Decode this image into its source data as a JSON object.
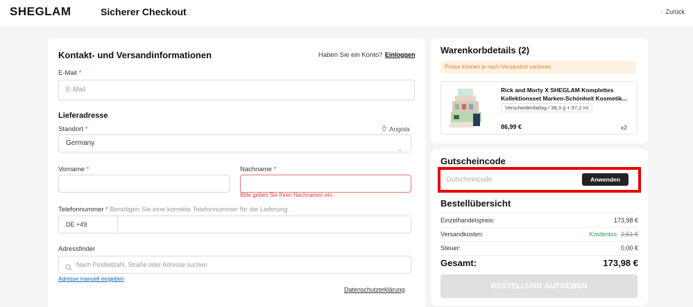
{
  "header": {
    "logo": "SHEGLAM",
    "title": "Sicherer Checkout",
    "back_label": "Zurück"
  },
  "contact": {
    "title": "Kontakt- und Versandinformationen",
    "account_prompt": "Haben Sie ein Konto?",
    "login_link": "Einloggen",
    "email_label": "E-Mail",
    "email_placeholder": "E-Mail",
    "address_title": "Lieferadresse",
    "location_label": "Standort",
    "location_hint": "Angola",
    "location_value": "Germany",
    "firstname_label": "Vorname",
    "lastname_label": "Nachname",
    "lastname_error": "Bitte geben Sie Ihren Nachnamen ein.",
    "phone_label": "Telefonnummer",
    "phone_hint": "Benötigen Sie eine korrekte Telefonnummer für die Lieferung.",
    "phone_prefix": "DE +49",
    "finder_label": "Adressfinder",
    "finder_placeholder": "Nach Postleitzahl, Straße oder Adresse suchen",
    "manual_link": "Adresse manuell eingeben",
    "privacy_link": "Datenschutzerklärung",
    "required_mark": "*"
  },
  "cart": {
    "title": "Warenkorbdetails (2)",
    "notice": "Preise können je nach Versandort variieren.",
    "product_name": "Rick and Morty X SHEGLAM Komplettes Kollektionsset Marken-Schönheit Kosmetik...",
    "variant": "Verschiedenfarbig / 38,3 g + 97,2 ml",
    "price": "86,99 €",
    "qty": "x2"
  },
  "coupon": {
    "title": "Gutscheincode",
    "placeholder": "Gutscheincode",
    "apply_label": "Anwenden"
  },
  "summary": {
    "title": "Bestellübersicht",
    "retail_label": "Einzelhandelspreis:",
    "retail_value": "173,98 €",
    "shipping_label": "Versandkosten:",
    "shipping_free": "Kostenlos",
    "shipping_old": "2,51 €",
    "tax_label": "Steuer:",
    "tax_value": "0,00 €",
    "total_label": "Gesamt:",
    "total_value": "173,98 €",
    "order_button": "BESTELLUNG AUFGEBEN"
  },
  "colors": {
    "accent_red": "#e53935",
    "free_green": "#2e9e56",
    "highlight": "#e60000"
  },
  "icons": [
    "chevron-left-icon",
    "pin-icon",
    "chevron-down-icon",
    "search-icon",
    "product-image"
  ]
}
